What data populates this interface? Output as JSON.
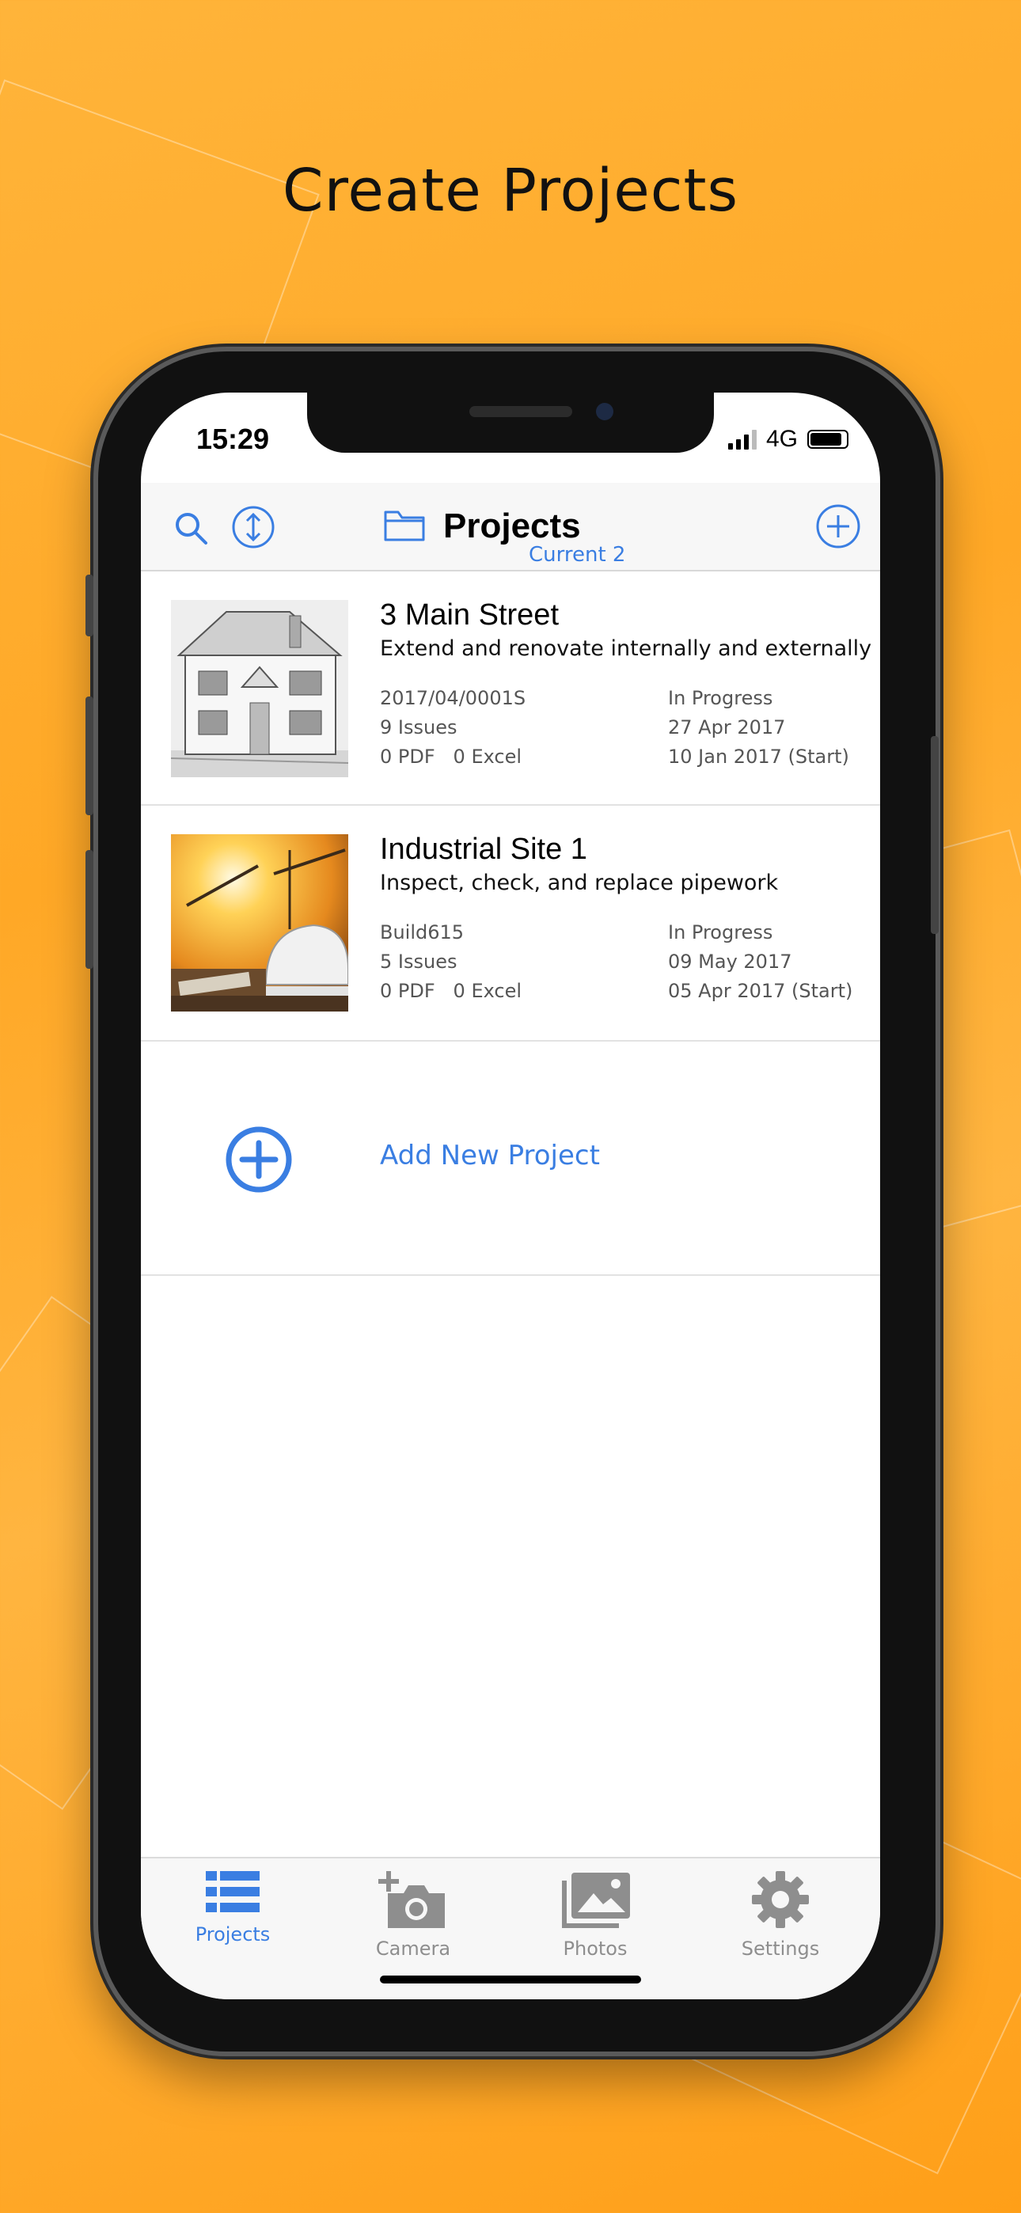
{
  "promo": {
    "title": "Create Projects"
  },
  "status_bar": {
    "time": "15:29",
    "network": "4G"
  },
  "nav": {
    "title": "Projects",
    "subtitle": "Current 2",
    "search_icon": "search-icon",
    "sort_icon": "sort-icon",
    "folder_icon": "folder-icon",
    "add_icon": "plus-circle-icon"
  },
  "projects": [
    {
      "title": "3 Main Street",
      "description": "Extend and renovate internally and externally",
      "reference": "2017/04/0001S",
      "issues": "9 Issues",
      "pdf": "0 PDF",
      "excel": "0 Excel",
      "status": "In Progress",
      "date": "27 Apr 2017",
      "start": "10 Jan 2017 (Start)"
    },
    {
      "title": "Industrial Site 1",
      "description": "Inspect, check, and replace pipework",
      "reference": "Build615",
      "issues": "5 Issues",
      "pdf": "0 PDF",
      "excel": "0 Excel",
      "status": "In Progress",
      "date": "09 May 2017",
      "start": "05 Apr 2017 (Start)"
    }
  ],
  "add_project": {
    "label": "Add New Project"
  },
  "tabs": [
    {
      "label": "Projects",
      "icon": "list-icon",
      "active": true
    },
    {
      "label": "Camera",
      "icon": "camera-add-icon",
      "active": false
    },
    {
      "label": "Photos",
      "icon": "photos-icon",
      "active": false
    },
    {
      "label": "Settings",
      "icon": "gear-icon",
      "active": false
    }
  ],
  "colors": {
    "accent": "#3a7ee2",
    "inactive": "#8e8e8e",
    "background": "#ffa826"
  }
}
